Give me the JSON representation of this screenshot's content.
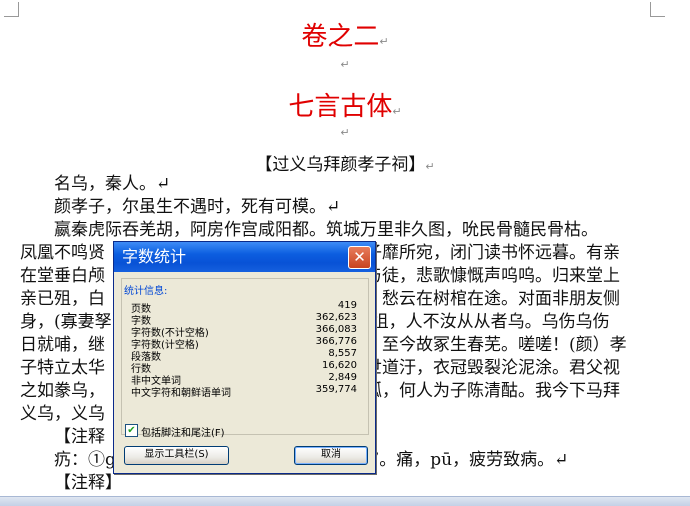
{
  "document": {
    "volume_title": "卷之二",
    "section_title": "七言古体",
    "poem_title": "【过义乌拜颜孝子祠】",
    "return_mark": "↵",
    "lines": [
      {
        "text": "名乌，秦人。↵",
        "indent": true
      },
      {
        "text": "颜孝子，尔虽生不遇时，死有可模。↵",
        "indent": true
      },
      {
        "text": "嬴秦虎际吞羌胡，阿房作宫咸阳都。筑城万里非久图，吮民骨髓民骨枯。",
        "indent": true
      },
      {
        "text": "凤凰不鸣贤",
        "tail": "子靡所宛，闭门读书怀远暮。有亲",
        "indent": false
      },
      {
        "text": "在堂垂白颅",
        "tail": "与徒，悲歌慷慨声呜呜。归来堂上",
        "indent": false
      },
      {
        "text": "亲已殂，白",
        "tail": "，愁云在树棺在途。对面非朋友侧",
        "indent": false
      },
      {
        "text": "身，(寡妻孥",
        "tail": "肯徂，人不汝从从者乌。乌伤乌伤",
        "indent": false
      },
      {
        "text": "日就哺，继",
        "tail": "，至今故冢生春芜。嗟嗟！(颜）孝",
        "indent": false
      },
      {
        "text": "子特立太华",
        "tail": "世道汙，衣冠毁裂沦泥涂。君父视",
        "indent": false
      },
      {
        "text": "之如豢乌，",
        "tail": "狐，何人为子陈清酤。我今下马拜",
        "indent": false
      },
      {
        "text": "义乌，义乌",
        "tail": "",
        "indent": false
      },
      {
        "text": "【注释",
        "tail": "",
        "indent": true
      },
      {
        "text": "疓：①gū 古同“贾”，买。②yíng 古同“赢”。痛，pū，疲劳致病。↵",
        "indent": true
      },
      {
        "text": "【注释】",
        "tail": "",
        "indent": true
      }
    ]
  },
  "dialog": {
    "title": "字数统计",
    "group_label": "统计信息:",
    "stats": [
      {
        "label": "页数",
        "value": "419"
      },
      {
        "label": "字数",
        "value": "362,623"
      },
      {
        "label": "字符数(不计空格)",
        "value": "366,083"
      },
      {
        "label": "字符数(计空格)",
        "value": "366,776"
      },
      {
        "label": "段落数",
        "value": "8,557"
      },
      {
        "label": "行数",
        "value": "16,620"
      },
      {
        "label": "非中文单词",
        "value": "2,849"
      },
      {
        "label": "中文字符和朝鲜语单词",
        "value": "359,774"
      }
    ],
    "checkbox_label": "包括脚注和尾注(F)",
    "checkbox_checked": true,
    "toolbar_button": "显示工具栏(S)",
    "cancel_button": "取消"
  }
}
